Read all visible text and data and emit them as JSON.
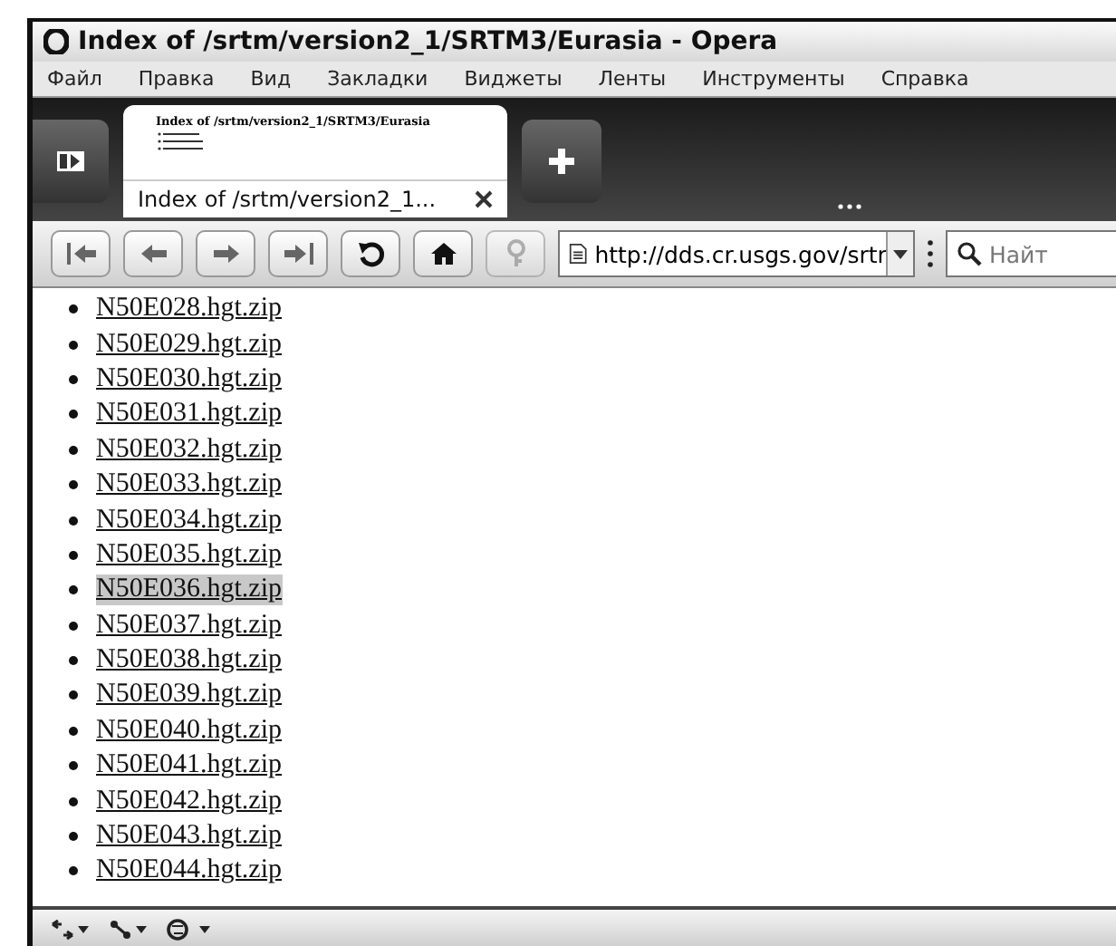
{
  "window": {
    "title": "Index of /srtm/version2_1/SRTM3/Eurasia - Opera"
  },
  "menu": [
    "Файл",
    "Правка",
    "Вид",
    "Закладки",
    "Виджеты",
    "Ленты",
    "Инструменты",
    "Справка"
  ],
  "tabs": [
    {
      "label": "Index of /srtm/version2_1...",
      "thumbnail_title": "Index of /srtm/version2_1/SRTM3/Eurasia",
      "selected": true
    }
  ],
  "address_bar": {
    "value": "http://dds.cr.usgs.gov/srtr"
  },
  "search": {
    "placeholder": "Найт"
  },
  "links": [
    {
      "text": "N50E028.hgt.zip",
      "selected": false
    },
    {
      "text": "N50E029.hgt.zip",
      "selected": false
    },
    {
      "text": "N50E030.hgt.zip",
      "selected": false
    },
    {
      "text": "N50E031.hgt.zip",
      "selected": false
    },
    {
      "text": "N50E032.hgt.zip",
      "selected": false
    },
    {
      "text": "N50E033.hgt.zip",
      "selected": false
    },
    {
      "text": "N50E034.hgt.zip",
      "selected": false
    },
    {
      "text": "N50E035.hgt.zip",
      "selected": false
    },
    {
      "text": "N50E036.hgt.zip",
      "selected": true
    },
    {
      "text": "N50E037.hgt.zip",
      "selected": false
    },
    {
      "text": "N50E038.hgt.zip",
      "selected": false
    },
    {
      "text": "N50E039.hgt.zip",
      "selected": false
    },
    {
      "text": "N50E040.hgt.zip",
      "selected": false
    },
    {
      "text": "N50E041.hgt.zip",
      "selected": false
    },
    {
      "text": "N50E042.hgt.zip",
      "selected": false
    },
    {
      "text": "N50E043.hgt.zip",
      "selected": false
    },
    {
      "text": "N50E044.hgt.zip",
      "selected": false
    }
  ]
}
